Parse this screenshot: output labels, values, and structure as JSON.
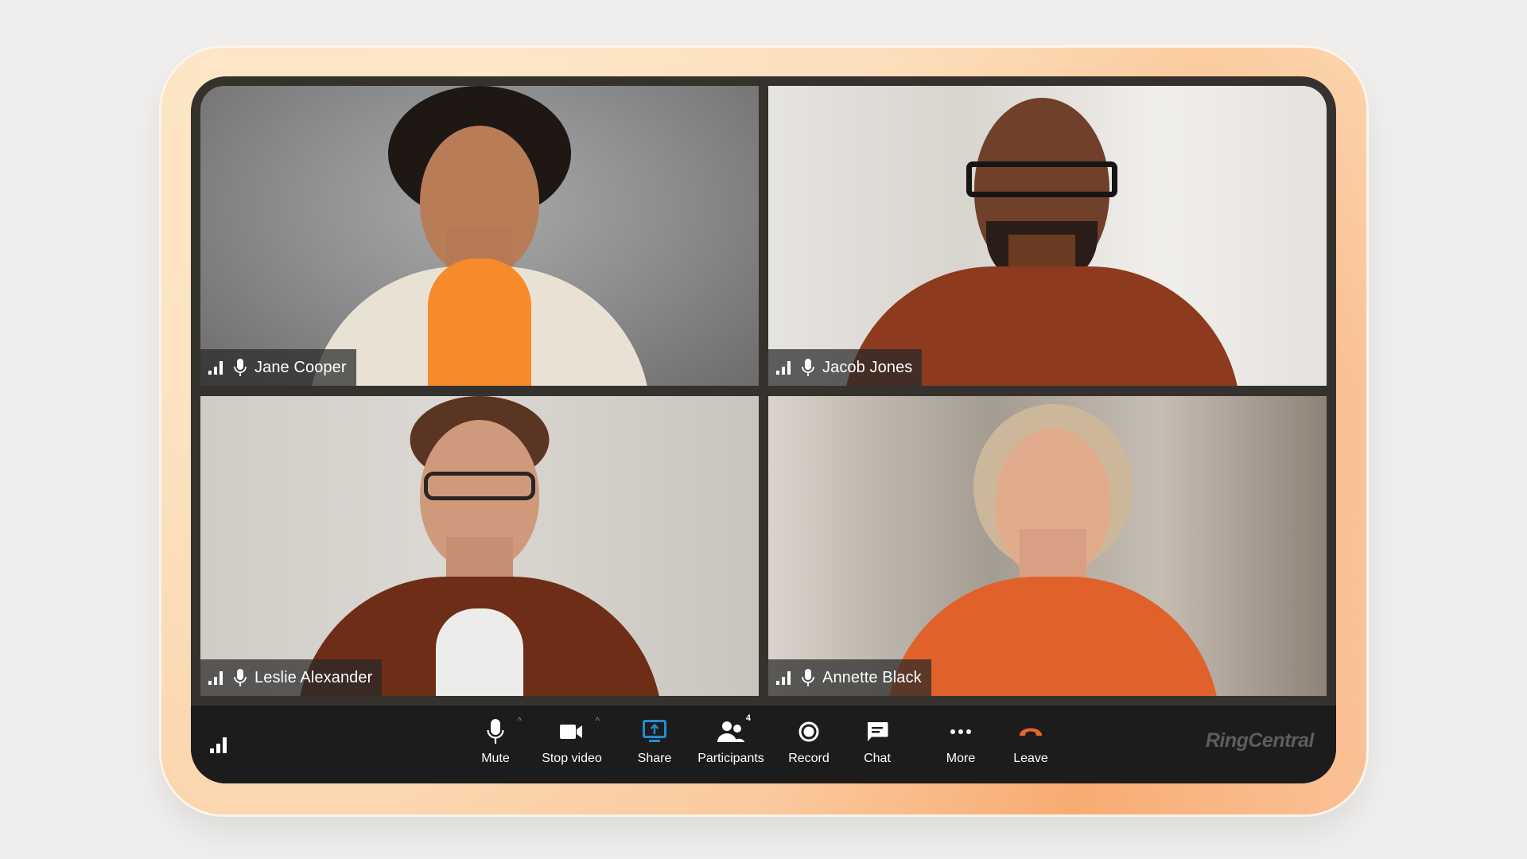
{
  "meeting": {
    "participants": [
      {
        "name": "Jane Cooper"
      },
      {
        "name": "Jacob Jones"
      },
      {
        "name": "Leslie Alexander"
      },
      {
        "name": "Annette Black"
      }
    ]
  },
  "toolbar": {
    "buttons": [
      {
        "id": "mute",
        "label": "Mute",
        "icon": "microphone-icon",
        "has_caret": true
      },
      {
        "id": "stop-video",
        "label": "Stop video",
        "icon": "video-camera-icon",
        "has_caret": true
      },
      {
        "id": "share",
        "label": "Share",
        "icon": "share-screen-icon",
        "color": "#1e8fd0"
      },
      {
        "id": "participants",
        "label": "Participants",
        "icon": "participants-icon",
        "badge": "4"
      },
      {
        "id": "record",
        "label": "Record",
        "icon": "record-icon"
      },
      {
        "id": "chat",
        "label": "Chat",
        "icon": "chat-icon"
      },
      {
        "id": "more",
        "label": "More",
        "icon": "more-dots-icon"
      },
      {
        "id": "leave",
        "label": "Leave",
        "icon": "hang-up-icon",
        "color": "#e8622b"
      }
    ],
    "caret": "^",
    "brand": "RingCentral"
  },
  "colors": {
    "share_accent": "#1e8fd0",
    "leave_accent": "#e8622b",
    "frame_gradient_warm": "#f8ac72",
    "frame_gradient_light": "#fde6c6",
    "device": "#35322e",
    "toolbar": "#1c1c1c"
  }
}
